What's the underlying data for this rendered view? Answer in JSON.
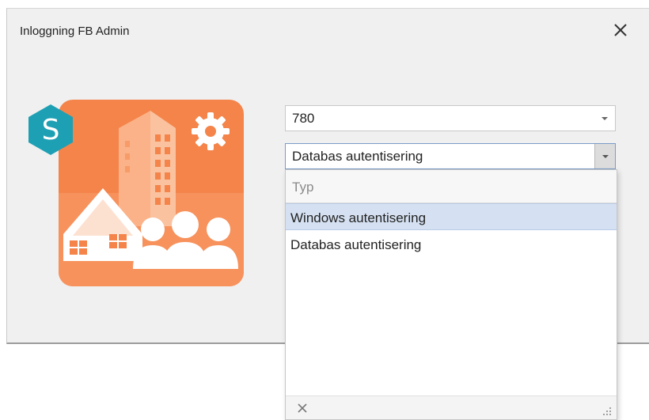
{
  "window": {
    "title": "Inloggning FB Admin"
  },
  "logo": {
    "letter": "S"
  },
  "server_combo": {
    "value": "780"
  },
  "auth_combo": {
    "value": "Databas autentisering"
  },
  "dropdown": {
    "header": "Typ",
    "items": [
      {
        "label": "Windows autentisering",
        "selected": true
      },
      {
        "label": "Databas autentisering",
        "selected": false
      }
    ]
  },
  "colors": {
    "logo_orange": "#f4844a",
    "logo_teal": "#1ea0b4",
    "selection": "#d5e1f2",
    "focus_border": "#7a9cc8"
  },
  "icons": {
    "close": "close-icon",
    "gear": "gear-icon",
    "dropdown": "chevron-down-icon",
    "clear": "clear-icon",
    "grip": "resize-grip-icon"
  }
}
